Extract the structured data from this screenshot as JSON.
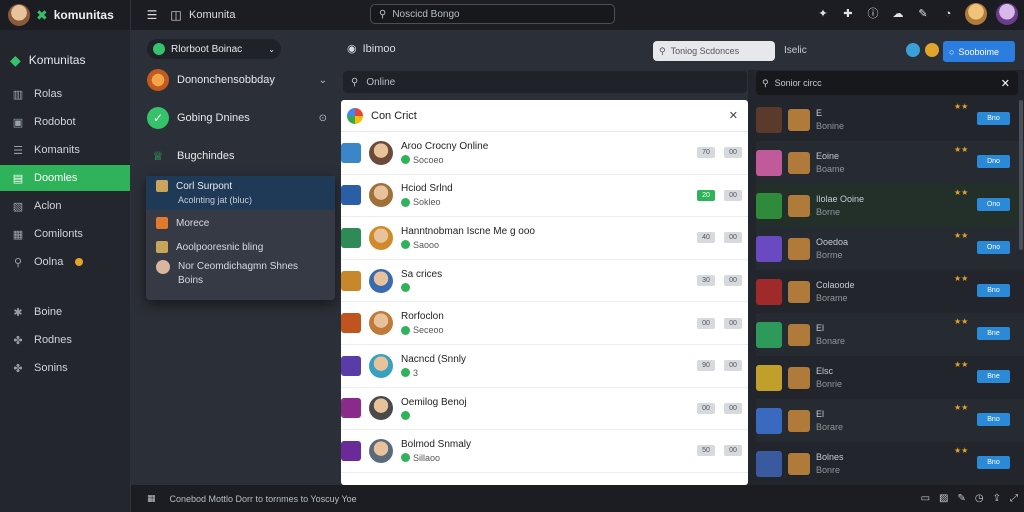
{
  "app": {
    "name": "komunitas",
    "window_title": "Komunita"
  },
  "topbar": {
    "search_placeholder": "Noscicd Bongo"
  },
  "leftnav": {
    "brand": "Komunitas",
    "items": [
      {
        "label": "Rolas",
        "icon": "chart-icon"
      },
      {
        "label": "Rodobot",
        "icon": "box-icon"
      },
      {
        "label": "Komanits",
        "icon": "list-icon"
      },
      {
        "label": "Doomles",
        "icon": "chat-icon",
        "active": true
      },
      {
        "label": "Aclon",
        "icon": "image-icon"
      },
      {
        "label": "Comilonts",
        "icon": "grid-icon"
      },
      {
        "label": "Oolna",
        "icon": "search-icon",
        "badge": true
      }
    ],
    "items2": [
      {
        "label": "Boine",
        "icon": "gear-icon"
      },
      {
        "label": "Rodnes",
        "icon": "people-icon"
      },
      {
        "label": "Sonins",
        "icon": "people-icon"
      }
    ]
  },
  "panel2": {
    "pill": "Rlorboot Boinac",
    "row1": "Dononchensobbday",
    "row2": "Gobing Dnines",
    "row3": "Bugchindes"
  },
  "menu": {
    "highlight_title": "Corl Surpont",
    "highlight_sub": "Acolnting jat (bluc)",
    "item1": "Morece",
    "item2": "Aoolpooresnic bling",
    "item3_l1": "Nor Ceomdichagmn Shnes",
    "item3_l2": "Boins"
  },
  "main": {
    "header": "Ibimoo",
    "search_placeholder": "Online",
    "list_title": "Con Crict",
    "rows": [
      {
        "name": "Aroo Crocny Online",
        "sub": "Socoeo",
        "a": "70",
        "b": "00",
        "on": false
      },
      {
        "name": "Hciod Srlnd",
        "sub": "Sokleo",
        "a": "20",
        "b": "00",
        "on": true
      },
      {
        "name": "Hanntnobman Iscne Me g ooo",
        "sub": "Saooo",
        "a": "40",
        "b": "00",
        "on": false
      },
      {
        "name": "Sa crices",
        "sub": "",
        "a": "30",
        "b": "00",
        "on": false
      },
      {
        "name": "Rorfoclon",
        "sub": "Seceoo",
        "a": "00",
        "b": "00",
        "on": false
      },
      {
        "name": "Nacncd (Snnly",
        "sub": "3",
        "a": "90",
        "b": "00",
        "on": false
      },
      {
        "name": "Oemilog Benoj",
        "sub": "",
        "a": "00",
        "b": "00",
        "on": false
      },
      {
        "name": "Bolmod Snmaly",
        "sub": "Sillaoo",
        "a": "50",
        "b": "00",
        "on": false
      }
    ]
  },
  "right": {
    "search_placeholder": "Toniog Scdonces",
    "label": "Iselic",
    "blue_btn": "Sooboime",
    "search2": "Sonior circc",
    "rows": [
      {
        "t1": "E",
        "t2": "Bonine",
        "btn": "Bno"
      },
      {
        "t1": "Eoine",
        "t2": "Boame",
        "btn": "Dno"
      },
      {
        "t1": "Ilolae Ooine",
        "t2": "Borne",
        "btn": "Ono"
      },
      {
        "t1": "Ooedoa",
        "t2": "Borme",
        "btn": "Ono"
      },
      {
        "t1": "Colaoode",
        "t2": "Borame",
        "btn": "Bno"
      },
      {
        "t1": "El",
        "t2": "Bonare",
        "btn": "Bne"
      },
      {
        "t1": "Elsc",
        "t2": "Bonrie",
        "btn": "Bne"
      },
      {
        "t1": "El",
        "t2": "Borare",
        "btn": "Bno"
      },
      {
        "t1": "Bolnes",
        "t2": "Bonre",
        "btn": "Bno"
      }
    ]
  },
  "bottom": {
    "status": "Conebod Mottlo Dorr to tornmes to Yoscuy  Yoe"
  }
}
